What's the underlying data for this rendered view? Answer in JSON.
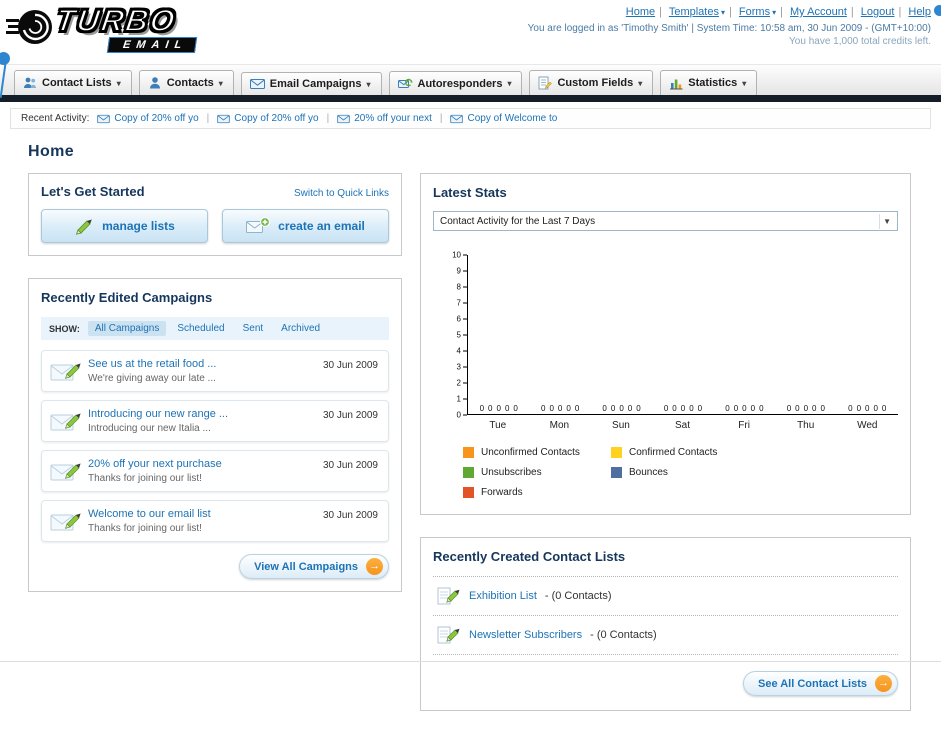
{
  "colors": {
    "link": "#1e73b6",
    "heading": "#16365c",
    "nav_dark_bar": "#151e28",
    "accent_orange": "#f7941d"
  },
  "header": {
    "logo_line1": "TURBO",
    "logo_line2": "EMAIL",
    "links": [
      "Home",
      "Templates",
      "Forms",
      "My Account",
      "Logout",
      "Help"
    ],
    "session_line": "You are logged in as 'Timothy Smith' | System Time: 10:58 am, 30 Jun 2009 - (GMT+10:00)",
    "credits_line": "You have 1,000 total credits left."
  },
  "nav": {
    "tabs": [
      {
        "label": "Contact Lists"
      },
      {
        "label": "Contacts"
      },
      {
        "label": "Email Campaigns"
      },
      {
        "label": "Autoresponders"
      },
      {
        "label": "Custom Fields"
      },
      {
        "label": "Statistics"
      }
    ]
  },
  "recent_activity": {
    "label": "Recent Activity:",
    "items": [
      "Copy of 20% off yo",
      "Copy of 20% off yo",
      "20% off your next",
      "Copy of Welcome to"
    ]
  },
  "page": {
    "title": "Home"
  },
  "get_started": {
    "title": "Let's Get Started",
    "switch_link": "Switch to Quick Links",
    "manage_lists_label": "manage lists",
    "create_email_label": "create an email"
  },
  "campaigns": {
    "title": "Recently Edited Campaigns",
    "show_label": "SHOW:",
    "filters": [
      "All Campaigns",
      "Scheduled",
      "Sent",
      "Archived"
    ],
    "items": [
      {
        "title": "See us at the retail food ...",
        "subtitle": "We're giving away our late ...",
        "date": "30 Jun 2009"
      },
      {
        "title": "Introducing our new range ...",
        "subtitle": "Introducing our new Italia ...",
        "date": "30 Jun 2009"
      },
      {
        "title": "20% off your next purchase",
        "subtitle": "Thanks for joining our list!",
        "date": "30 Jun 2009"
      },
      {
        "title": "Welcome to our email list",
        "subtitle": "Thanks for joining our list!",
        "date": "30 Jun 2009"
      }
    ],
    "view_all_label": "View All Campaigns"
  },
  "latest_stats": {
    "title": "Latest Stats",
    "selected_option": "Contact Activity for the Last 7 Days",
    "chart_data": {
      "type": "bar",
      "title": "Contact Activity for the Last 7 Days",
      "categories": [
        "Tue",
        "Mon",
        "Sun",
        "Sat",
        "Fri",
        "Thu",
        "Wed"
      ],
      "series": [
        {
          "name": "Unconfirmed Contacts",
          "color": "#f7941d",
          "values": [
            0,
            0,
            0,
            0,
            0,
            0,
            0
          ]
        },
        {
          "name": "Confirmed Contacts",
          "color": "#ffd21e",
          "values": [
            0,
            0,
            0,
            0,
            0,
            0,
            0
          ]
        },
        {
          "name": "Unsubscribes",
          "color": "#61a832",
          "values": [
            0,
            0,
            0,
            0,
            0,
            0,
            0
          ]
        },
        {
          "name": "Bounces",
          "color": "#4f6fa0",
          "values": [
            0,
            0,
            0,
            0,
            0,
            0,
            0
          ]
        },
        {
          "name": "Forwards",
          "color": "#e25426",
          "values": [
            0,
            0,
            0,
            0,
            0,
            0,
            0
          ]
        }
      ],
      "ylim": [
        0,
        10
      ],
      "yticks": [
        0,
        1,
        2,
        3,
        4,
        5,
        6,
        7,
        8,
        9,
        10
      ],
      "legend_position": "bottom",
      "grid": false
    }
  },
  "contact_lists": {
    "title": "Recently Created Contact Lists",
    "items": [
      {
        "name": "Exhibition List",
        "detail": "- (0 Contacts)"
      },
      {
        "name": "Newsletter Subscribers",
        "detail": "- (0 Contacts)"
      }
    ],
    "see_all_label": "See All Contact Lists"
  }
}
